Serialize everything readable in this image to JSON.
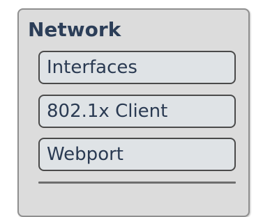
{
  "panel": {
    "title": "Network",
    "items": [
      {
        "label": "Interfaces"
      },
      {
        "label": "802.1x Client"
      },
      {
        "label": "Webport"
      }
    ]
  }
}
